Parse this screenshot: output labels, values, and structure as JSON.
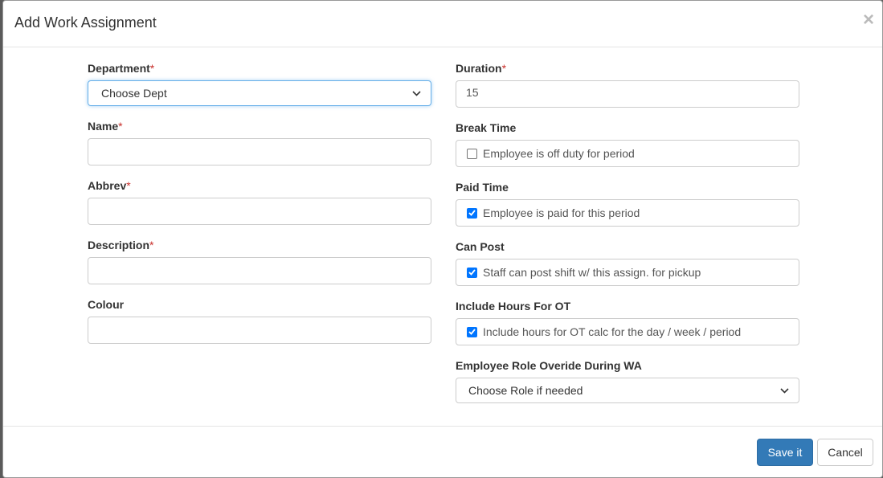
{
  "modal": {
    "title": "Add Work Assignment",
    "close_glyph": "×"
  },
  "left": {
    "department": {
      "label": "Department",
      "required": "*",
      "value": "Choose Dept"
    },
    "name": {
      "label": "Name",
      "required": "*",
      "value": ""
    },
    "abbrev": {
      "label": "Abbrev",
      "required": "*",
      "value": ""
    },
    "description": {
      "label": "Description",
      "required": "*",
      "value": ""
    },
    "colour": {
      "label": "Colour",
      "value": ""
    }
  },
  "right": {
    "duration": {
      "label": "Duration",
      "required": "*",
      "value": "15"
    },
    "break_time": {
      "label": "Break Time",
      "text": "Employee is off duty for period",
      "checked": false
    },
    "paid_time": {
      "label": "Paid Time",
      "text": "Employee is paid for this period",
      "checked": true
    },
    "can_post": {
      "label": "Can Post",
      "text": "Staff can post shift w/ this assign. for pickup",
      "checked": true
    },
    "include_ot": {
      "label": "Include Hours For OT",
      "text": "Include hours for OT calc for the day / week / period",
      "checked": true
    },
    "role_override": {
      "label": "Employee Role Overide During WA",
      "value": "Choose Role if needed"
    }
  },
  "footer": {
    "save_label": "Save it",
    "cancel_label": "Cancel"
  },
  "colors": {
    "primary": "#337ab7",
    "required": "#c9302c",
    "checkbox": "#0075ff"
  }
}
